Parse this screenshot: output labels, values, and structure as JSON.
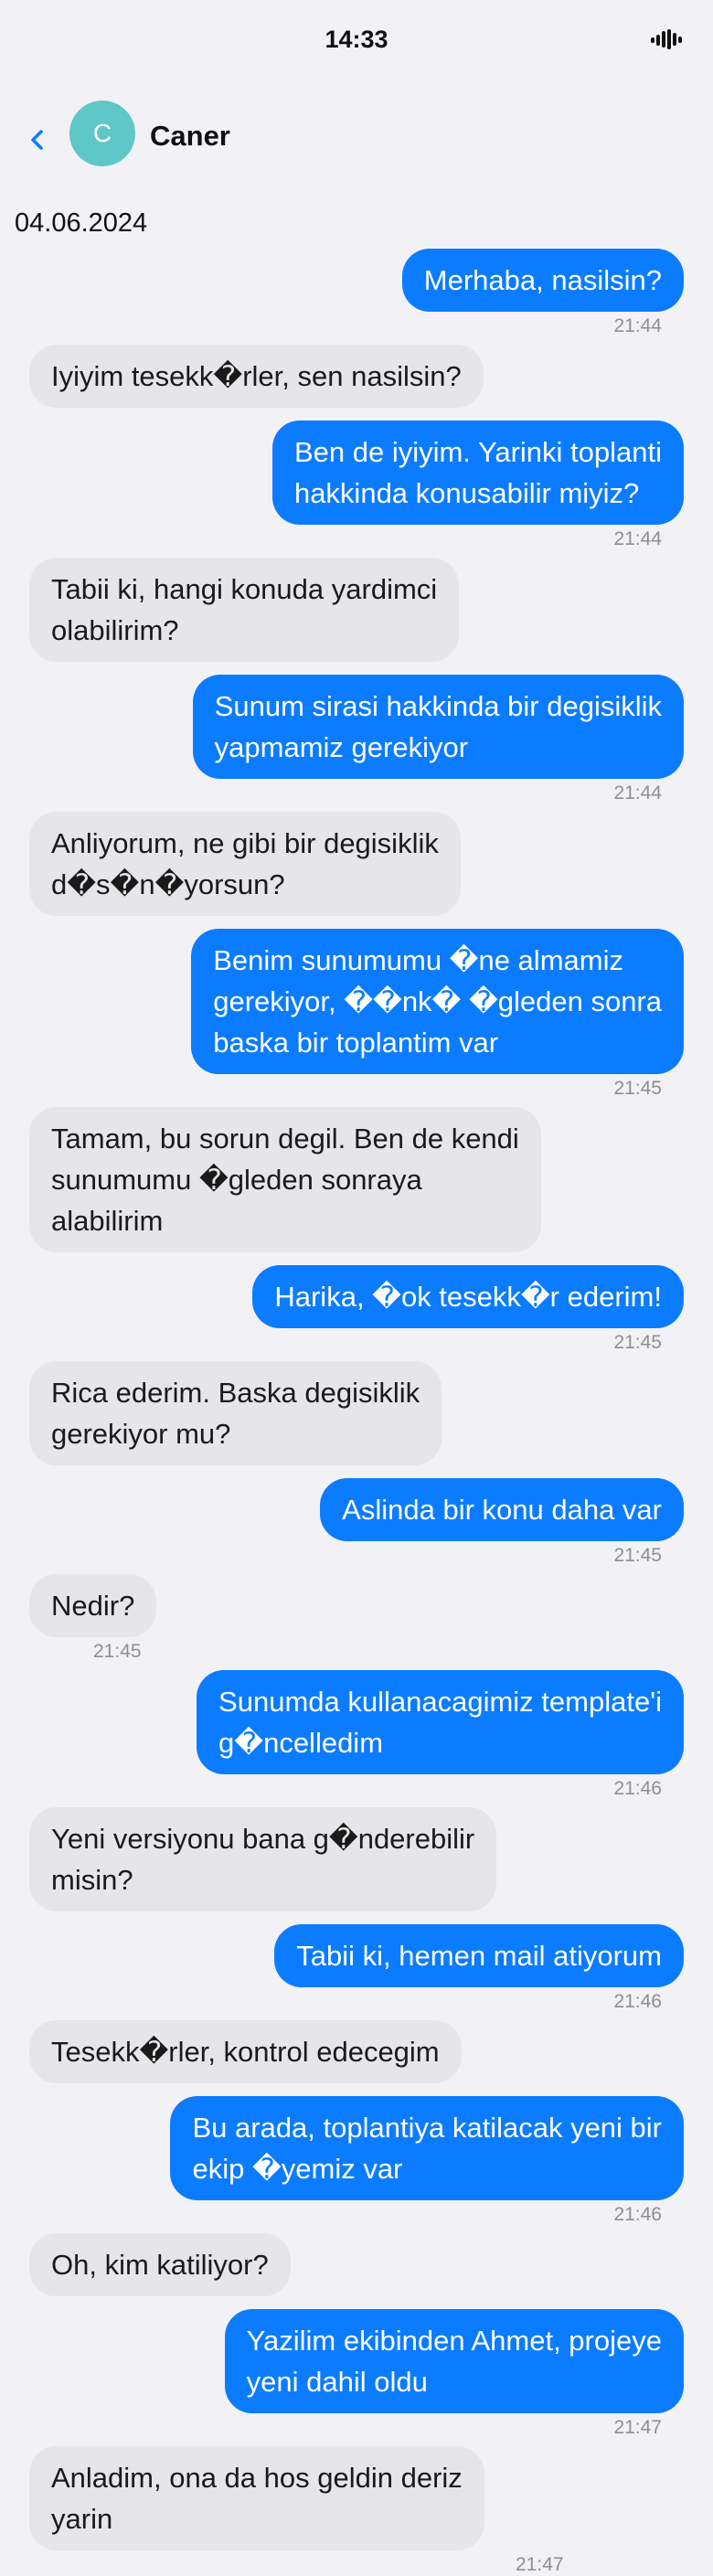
{
  "status_bar": {
    "time": "14:33",
    "icon": "signal-icon"
  },
  "header": {
    "back_icon": "chevron-left-icon",
    "avatar_initial": "C",
    "contact_name": "Caner"
  },
  "date": "04.06.2024",
  "colors": {
    "outgoing": "#0b7cff",
    "incoming": "#e5e5ea",
    "avatar": "#5fc7c7",
    "back": "#0b7cff"
  },
  "messages": [
    {
      "direction": "out",
      "text": "Merhaba, nasilsin?",
      "time": "21:44"
    },
    {
      "direction": "in",
      "text": "Iyiyim tesekk�rler, sen nasilsin?",
      "time": ""
    },
    {
      "direction": "out",
      "text": "Ben de iyiyim. Yarinki toplanti\nhakkinda konusabilir miyiz?",
      "time": "21:44"
    },
    {
      "direction": "in",
      "text": "Tabii ki, hangi konuda yardimci\nolabilirim?",
      "time": ""
    },
    {
      "direction": "out",
      "text": "Sunum sirasi hakkinda bir degisiklik\nyapmamiz gerekiyor",
      "time": "21:44"
    },
    {
      "direction": "in",
      "text": "Anliyorum, ne gibi bir degisiklik\nd�s�n�yorsun?",
      "time": ""
    },
    {
      "direction": "out",
      "text": "Benim sunumumu �ne almamiz\ngerekiyor, ��nk� �gleden sonra\nbaska bir toplantim var",
      "time": "21:45"
    },
    {
      "direction": "in",
      "text": "Tamam, bu sorun degil. Ben de kendi\nsunumumu �gleden sonraya\nalabilirim",
      "time": ""
    },
    {
      "direction": "out",
      "text": "Harika, �ok tesekk�r ederim!",
      "time": "21:45"
    },
    {
      "direction": "in",
      "text": "Rica ederim. Baska degisiklik\ngerekiyor mu?",
      "time": ""
    },
    {
      "direction": "out",
      "text": "Aslinda bir konu daha var",
      "time": "21:45"
    },
    {
      "direction": "in",
      "text": "Nedir?",
      "time": "21:45"
    },
    {
      "direction": "out",
      "text": "Sunumda kullanacagimiz template'i\ng�ncelledim",
      "time": "21:46"
    },
    {
      "direction": "in",
      "text": "Yeni versiyonu bana g�nderebilir\nmisin?",
      "time": ""
    },
    {
      "direction": "out",
      "text": "Tabii ki, hemen mail atiyorum",
      "time": "21:46"
    },
    {
      "direction": "in",
      "text": "Tesekk�rler, kontrol edecegim",
      "time": ""
    },
    {
      "direction": "out",
      "text": "Bu arada, toplantiya katilacak yeni bir\nekip �yemiz var",
      "time": "21:46"
    },
    {
      "direction": "in",
      "text": "Oh, kim katiliyor?",
      "time": ""
    },
    {
      "direction": "out",
      "text": "Yazilim ekibinden Ahmet, projeye\nyeni dahil oldu",
      "time": "21:47"
    },
    {
      "direction": "in",
      "text": "Anladim, ona da hos geldin deriz\nyarin",
      "time": "21:47"
    }
  ]
}
